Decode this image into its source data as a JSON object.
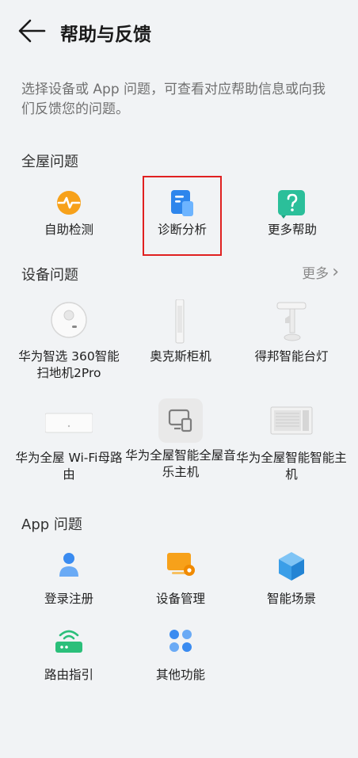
{
  "header": {
    "title": "帮助与反馈",
    "back_icon": "arrow-left-icon"
  },
  "description": "选择设备或 App 问题，可查看对应帮助信息或向我们反馈您的问题。",
  "whole_house": {
    "title": "全屋问题",
    "items": [
      {
        "label": "自助检测",
        "icon": "health-check-icon",
        "color": "#f7a11a"
      },
      {
        "label": "诊断分析",
        "icon": "diagnosis-report-icon",
        "color": "#3a8bf0",
        "highlighted": true
      },
      {
        "label": "更多帮助",
        "icon": "help-question-icon",
        "color": "#2bbf9a"
      }
    ]
  },
  "devices": {
    "title": "设备问题",
    "more_label": "更多",
    "items": [
      {
        "label": "华为智选 360智能扫地机2Pro",
        "icon": "robot-vacuum-icon"
      },
      {
        "label": "奥克斯柜机",
        "icon": "floor-ac-icon"
      },
      {
        "label": "得邦智能台灯",
        "icon": "desk-lamp-icon"
      },
      {
        "label": "华为全屋 Wi-Fi母路由",
        "icon": "wifi-router-panel-icon"
      },
      {
        "label": "华为全屋智能全屋音乐主机",
        "icon": "music-host-icon"
      },
      {
        "label": "华为全屋智能智能主机",
        "icon": "smart-host-icon"
      }
    ]
  },
  "app": {
    "title": "App 问题",
    "items": [
      {
        "label": "登录注册",
        "icon": "user-login-icon",
        "color": "#3a8bf0"
      },
      {
        "label": "设备管理",
        "icon": "device-management-icon",
        "color": "#f7a11a"
      },
      {
        "label": "智能场景",
        "icon": "smart-scene-icon",
        "color": "#3a9ee8"
      },
      {
        "label": "路由指引",
        "icon": "router-guide-icon",
        "color": "#2bbf7a"
      },
      {
        "label": "其他功能",
        "icon": "other-functions-icon",
        "color": "#3a8bf0"
      }
    ]
  }
}
